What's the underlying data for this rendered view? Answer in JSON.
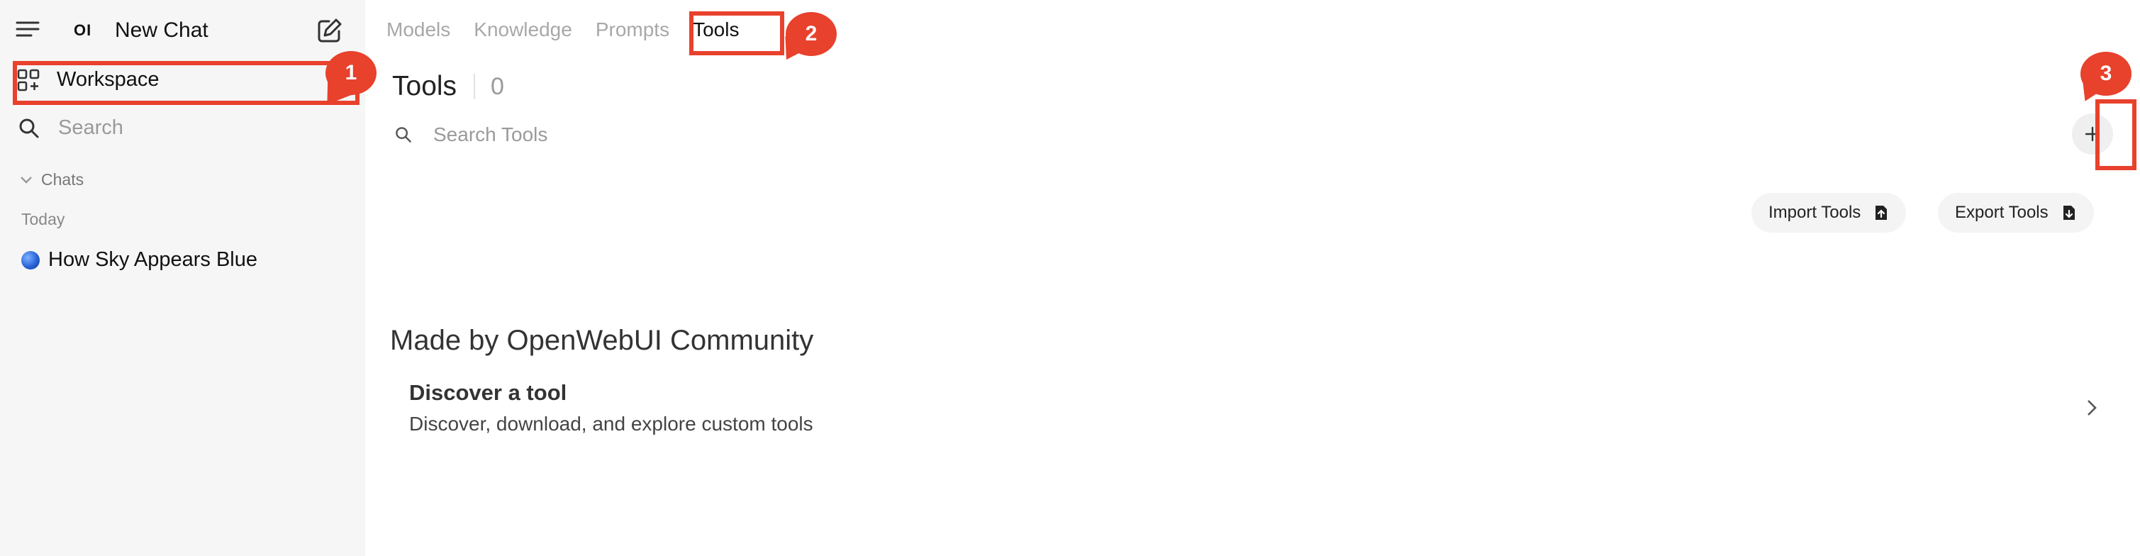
{
  "sidebar": {
    "logo_text": "OI",
    "new_chat_label": "New Chat",
    "workspace_label": "Workspace",
    "search_placeholder": "Search",
    "chats_label": "Chats",
    "today_label": "Today",
    "chat_items": [
      {
        "label": "How Sky Appears Blue",
        "icon": "blue-circle-emoji"
      }
    ]
  },
  "main": {
    "tabs": [
      {
        "label": "Models"
      },
      {
        "label": "Knowledge"
      },
      {
        "label": "Prompts"
      },
      {
        "label": "Tools",
        "active": true
      }
    ],
    "page_title": "Tools",
    "tool_count": "0",
    "search_placeholder": "Search Tools",
    "import_label": "Import Tools",
    "export_label": "Export Tools",
    "community_heading": "Made by OpenWebUI Community",
    "discover_title": "Discover a tool",
    "discover_subtitle": "Discover, download, and explore custom tools"
  },
  "annotations": [
    {
      "number": "1"
    },
    {
      "number": "2"
    },
    {
      "number": "3"
    }
  ],
  "colors": {
    "annotation": "#e8412c",
    "sidebar_bg": "#f6f6f6",
    "muted_text": "#9a9a9a"
  }
}
